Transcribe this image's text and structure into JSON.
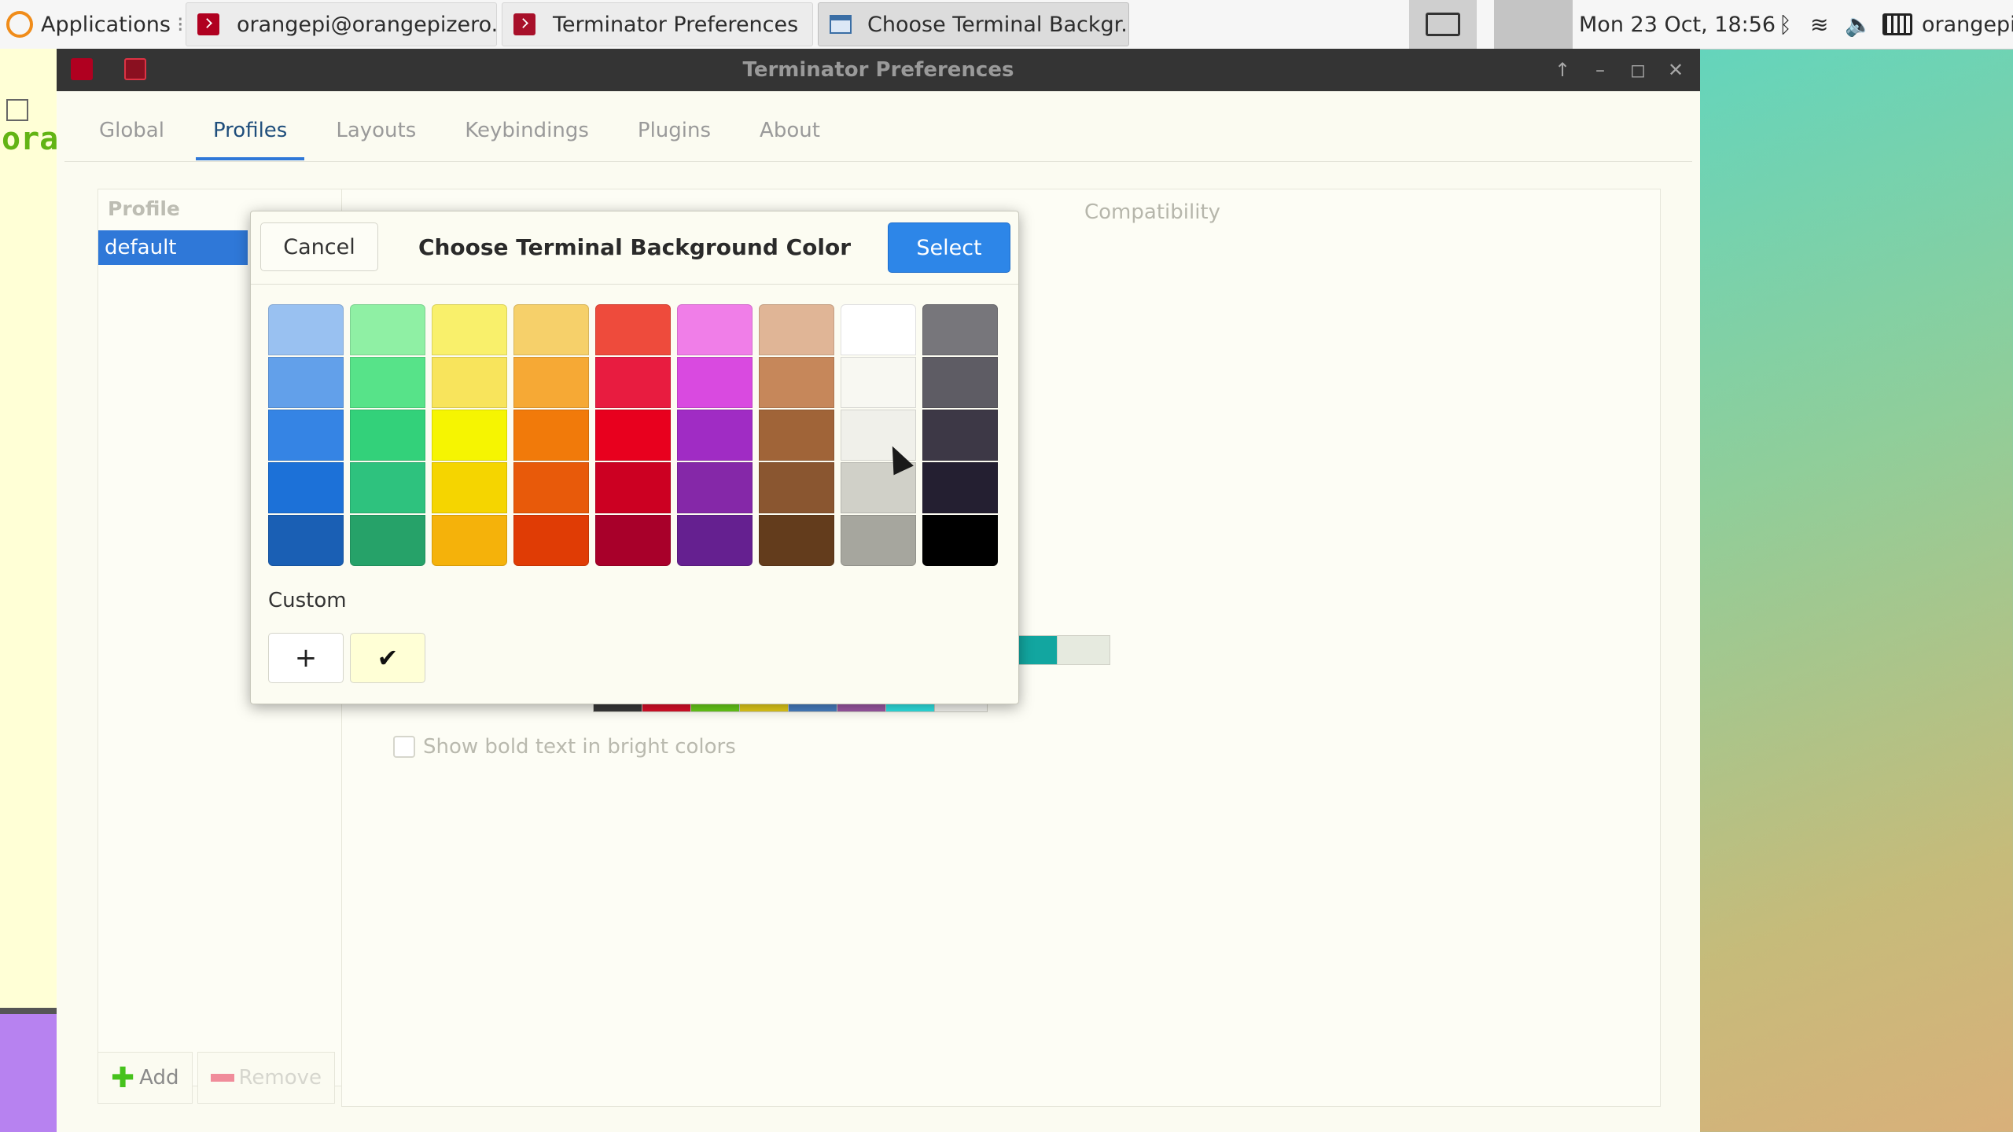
{
  "panel": {
    "applications_label": "Applications",
    "tasks": [
      {
        "label": "orangepi@orangepizero..."
      },
      {
        "label": "Terminator Preferences"
      },
      {
        "label": "Choose Terminal Backgr..."
      }
    ],
    "clock": "Mon 23 Oct, 18:56",
    "user": "orangepi"
  },
  "terminal": {
    "visible_text": "ora"
  },
  "window": {
    "title": "Terminator Preferences",
    "tabs": [
      "Global",
      "Profiles",
      "Layouts",
      "Keybindings",
      "Plugins",
      "About"
    ],
    "active_tab": "Profiles",
    "profile_header": "Profile",
    "profiles": [
      "default"
    ],
    "visible_subtab": "Compatibility",
    "add_label": "Add",
    "remove_label": "Remove",
    "bold_bright_label": "Show bold text in bright colors",
    "bold_bright_checked": false,
    "visible_palette_row1": [
      "#12a6a0",
      "#e6eadf"
    ],
    "visible_palette_row2": [
      "#3a3a3a",
      "#e0102a",
      "#6ad21a",
      "#e8d01a",
      "#4a82c6",
      "#a05aa8",
      "#2fe8e8",
      "#f8f8f4"
    ]
  },
  "dialog": {
    "title": "Choose Terminal Background Color",
    "cancel_label": "Cancel",
    "select_label": "Select",
    "custom_label": "Custom",
    "custom_add_label": "+",
    "custom_colors": [
      "#ffffd6"
    ],
    "custom_selected_mark": "✔",
    "palette": [
      [
        "#99c1f1",
        "#62a0ea",
        "#3584e4",
        "#1c71d8",
        "#1a5fb4"
      ],
      [
        "#8ff0a4",
        "#57e389",
        "#33d17a",
        "#2ec27e",
        "#26a269"
      ],
      [
        "#f9f06b",
        "#f8e45c",
        "#f6f501",
        "#f5d500",
        "#f5b20a"
      ],
      [
        "#f6d06a",
        "#f6a935",
        "#f17a0a",
        "#e85a0a",
        "#e03c05"
      ],
      [
        "#ee4b3c",
        "#e81c40",
        "#e8001e",
        "#cc0022",
        "#a8002a"
      ],
      [
        "#f07ee8",
        "#d94ae0",
        "#a02cc4",
        "#8528a8",
        "#652090"
      ],
      [
        "#e0b596",
        "#c6875a",
        "#a06438",
        "#8a5630",
        "#633c1c"
      ],
      [
        "#ffffff",
        "#f8f8f2",
        "#f0f0ea",
        "#d0d0c8",
        "#a6a69e"
      ],
      [
        "#77767b",
        "#5e5c64",
        "#3d3846",
        "#241f31",
        "#000000"
      ]
    ]
  }
}
